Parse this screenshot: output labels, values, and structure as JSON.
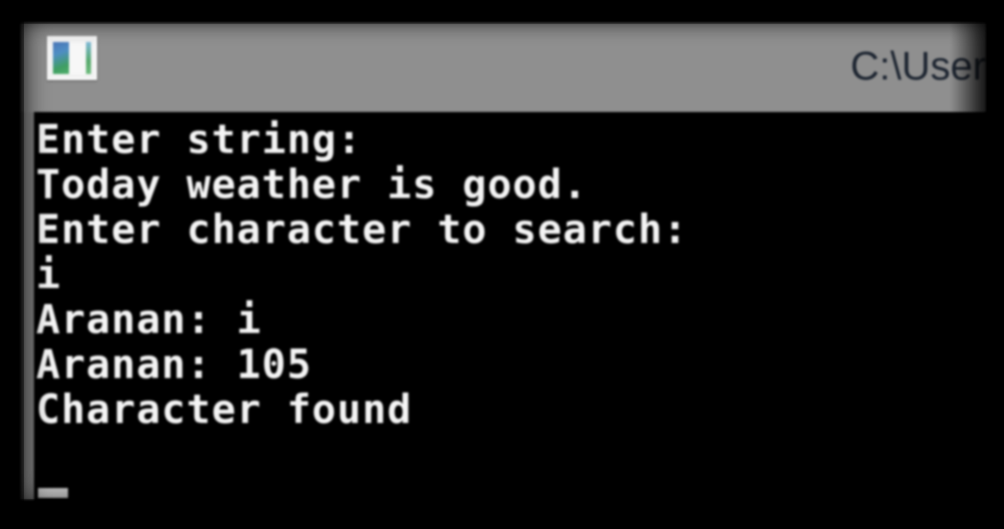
{
  "window": {
    "title": "C:\\User",
    "title_truncated": true,
    "icon_name": "console-app-icon",
    "titlebar_color": "#8f8f8f",
    "background_color": "#000000",
    "text_color": "#f4f4f4"
  },
  "console": {
    "lines": [
      "Enter string:",
      "Today weather is good.",
      "Enter character to search:",
      "i",
      "Aranan: i",
      "Aranan: 105",
      "Character found"
    ],
    "cursor": {
      "visible": true,
      "shape": "underscore-block",
      "line": 8,
      "column": 1
    }
  }
}
